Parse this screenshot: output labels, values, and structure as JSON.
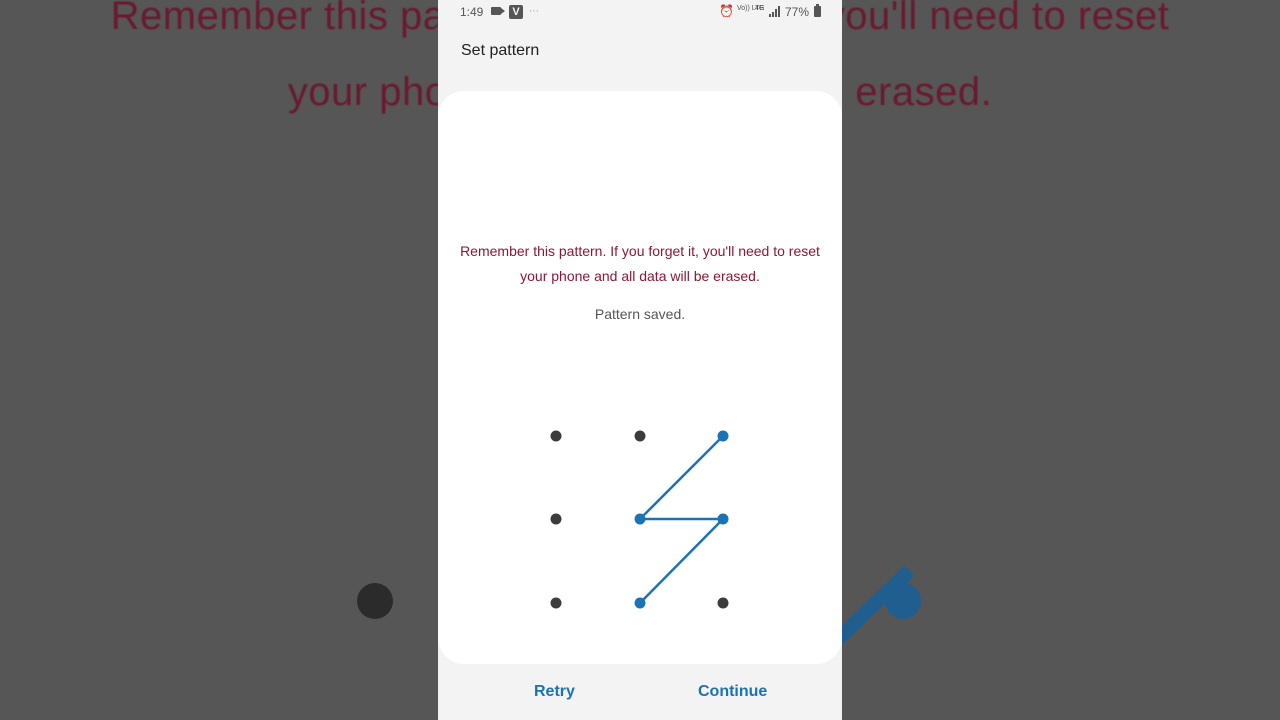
{
  "status_bar": {
    "time": "1:49",
    "app_badge": "V",
    "volte": "Vo)) LTE",
    "network": "4G",
    "battery": "77%"
  },
  "header": {
    "title": "Set pattern"
  },
  "message": {
    "warning": "Remember this pattern. If you forget it, you'll need to reset your phone and all data will be erased.",
    "status": "Pattern saved."
  },
  "pattern": {
    "selected_dots": [
      2,
      4,
      5,
      7
    ],
    "sequence": [
      2,
      4,
      5,
      7
    ],
    "active_color": "#1a73b5",
    "inactive_color": "#3c3c3c"
  },
  "actions": {
    "retry_label": "Retry",
    "continue_label": "Continue",
    "accent": "#1a73b5"
  },
  "colors": {
    "warning": "#8c1736"
  }
}
